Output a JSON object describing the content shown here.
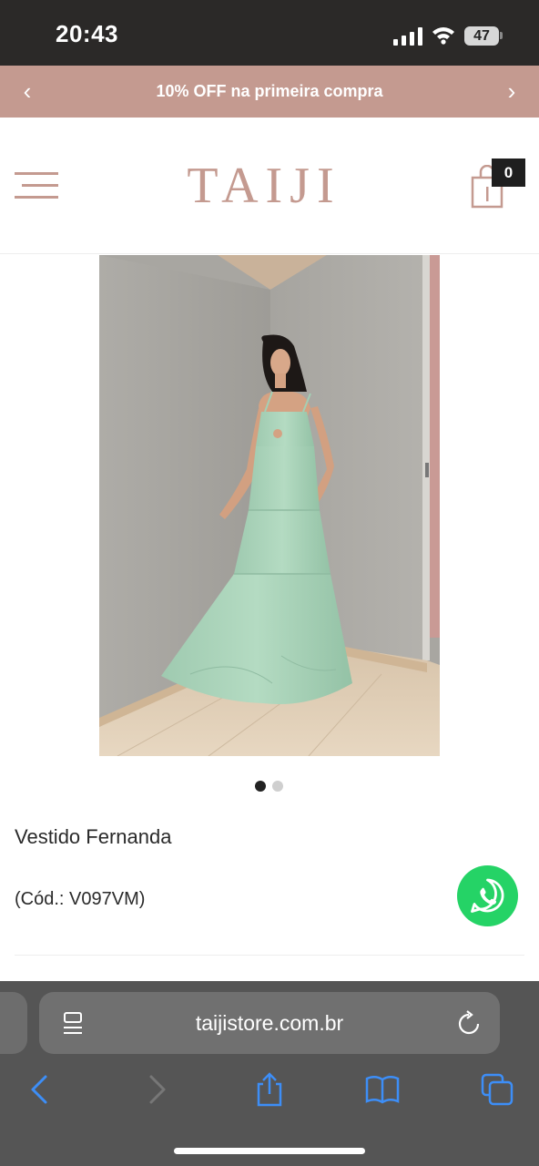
{
  "status_bar": {
    "time": "20:43",
    "battery": "47",
    "icons": [
      "signal-icon",
      "wifi-icon",
      "battery-icon"
    ]
  },
  "promo_banner": {
    "text": "10% OFF na primeira compra",
    "prev_label": "‹",
    "next_label": "›"
  },
  "header": {
    "logo": "TAIJI",
    "cart_count": "0",
    "icons": [
      "menu-icon",
      "shopping-bag-icon"
    ]
  },
  "product": {
    "image": "product-photo",
    "carousel": {
      "total": 2,
      "active": 1
    },
    "name": "Vestido Fernanda",
    "code": "(Cód.: V097VM)"
  },
  "browser": {
    "url": "taijistore.com.br",
    "icons": [
      "reader-icon",
      "reload-icon",
      "back-icon",
      "forward-icon",
      "share-icon",
      "bookmarks-icon",
      "tabs-icon"
    ]
  },
  "colors": {
    "brand": "#c49a90",
    "whatsapp": "#25d366",
    "dress": "#a4cfb5"
  }
}
